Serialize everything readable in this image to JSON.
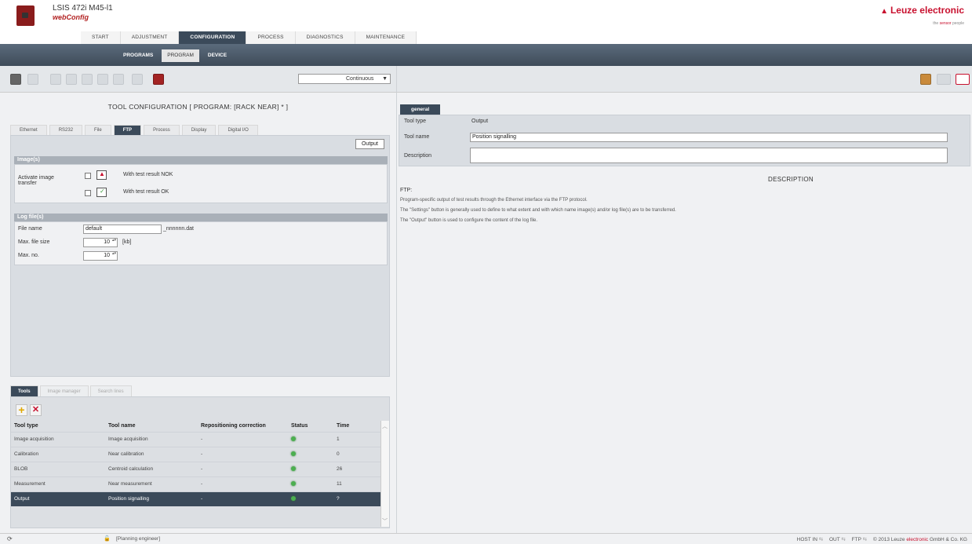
{
  "header": {
    "device_title": "LSIS 472i M45-l1",
    "app_subtitle": "webConfig",
    "brand": "Leuze electronic",
    "tagline_prefix": "the ",
    "tagline_em": "sensor",
    "tagline_suffix": " people"
  },
  "main_tabs": [
    "START",
    "ADJUSTMENT",
    "CONFIGURATION",
    "PROCESS",
    "DIAGNOSTICS",
    "MAINTENANCE"
  ],
  "sub_tabs": [
    "PROGRAMS",
    "PROGRAM",
    "DEVICE"
  ],
  "toolbar": {
    "mode_select": "Continuous"
  },
  "config": {
    "title": "TOOL CONFIGURATION   [ PROGRAM: [RACK NEAR] * ]",
    "tabs": [
      "Ethernet",
      "RS232",
      "File",
      "FTP",
      "Process",
      "Display",
      "Digital I/O"
    ],
    "output_button": "Output",
    "images_group": "Image(s)",
    "activate_label_1": "Activate image",
    "activate_label_2": "transfer",
    "nok_label": "With test result NOK",
    "ok_label": "With test result OK",
    "log_group": "Log file(s)",
    "file_name_label": "File name",
    "file_name_value": "default",
    "file_name_suffix": "_nnnnnn.dat",
    "max_size_label": "Max. file size",
    "max_size_value": "10",
    "max_size_unit": "[kb]",
    "max_no_label": "Max. no.",
    "max_no_value": "10"
  },
  "tools": {
    "tabs": [
      "Tools",
      "Image manager",
      "Search lines"
    ],
    "columns": [
      "Tool type",
      "Tool name",
      "Repositioning correction",
      "Status",
      "Time"
    ],
    "rows": [
      {
        "type": "Image acquisition",
        "name": "Image acquisition",
        "repos": "-",
        "time": "1"
      },
      {
        "type": "Calibration",
        "name": "Near calibration",
        "repos": "-",
        "time": "0"
      },
      {
        "type": "BLOB",
        "name": "Centroid calculation",
        "repos": "-",
        "time": "26"
      },
      {
        "type": "Measurement",
        "name": "Near measurement",
        "repos": "-",
        "time": "11"
      },
      {
        "type": "Output",
        "name": "Position signalling",
        "repos": "-",
        "time": "?"
      }
    ]
  },
  "general": {
    "tab": "general",
    "tool_type_label": "Tool type",
    "tool_type_value": "Output",
    "tool_name_label": "Tool name",
    "tool_name_value": "Position signalling",
    "description_label": "Description"
  },
  "description": {
    "heading": "DESCRIPTION",
    "title": "FTP:",
    "lines": [
      "Program-specific output of test results through the Ethernet interface via the FTP protocol.",
      "The \"Settings\" button is generally used to define to what extent and with which name image(s) and/or log file(s) are to be transferred.",
      "The \"Output\" button is used to configure the content of the log file."
    ]
  },
  "statusbar": {
    "user": "[Planning engineer]",
    "host_in": "HOST IN",
    "out": "OUT",
    "ftp": "FTP",
    "copyright_prefix": "© 2013 Leuze ",
    "copyright_em": "electronic",
    "copyright_suffix": " GmbH & Co. KG"
  },
  "colors": {
    "brand_red": "#c8102e",
    "nav_dark": "#3b4a5a",
    "status_ok": "#4caf50"
  }
}
